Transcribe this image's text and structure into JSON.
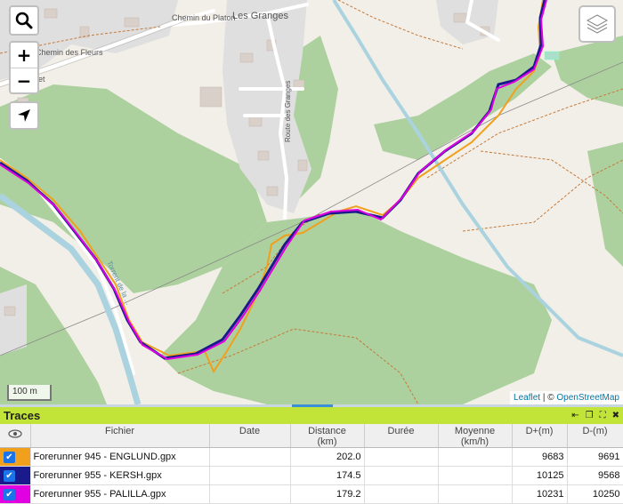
{
  "map": {
    "labels": {
      "les_granges": "Les Granges",
      "chemin_platon": "Chemin du Platon",
      "chemin_fleurs": "Chemin des Fleurs",
      "route_granges": "Route des Granges",
      "torrent": "Torrent de la ...",
      "cut_left": "het"
    },
    "zoom_in": "+",
    "zoom_out": "−",
    "scale_label": "100 m",
    "attribution": {
      "leaflet": "Leaflet",
      "sep": " | © ",
      "osm": "OpenStreetMap"
    },
    "track_colors": {
      "englund": "#f0a01c",
      "kersh": "#1a1a8c",
      "palilla": "#e100e1"
    }
  },
  "panel": {
    "title": "Traces",
    "icons": {
      "dock": "⇤",
      "restore": "❐",
      "expand": "⛶",
      "close": "✖"
    },
    "columns": [
      "",
      "Fichier",
      "Date",
      "Distance\n(km)",
      "Durée",
      "Moyenne\n(km/h)",
      "D+(m)",
      "D-(m)"
    ],
    "rows": [
      {
        "color": "#f0a01c",
        "checked": true,
        "file": "Forerunner 945 - ENGLUND.gpx",
        "date": "",
        "distance": "202.0",
        "duration": "",
        "speed": "",
        "dplus": "9683",
        "dminus": "9691"
      },
      {
        "color": "#1a1a8c",
        "checked": true,
        "file": "Forerunner 955 - KERSH.gpx",
        "date": "",
        "distance": "174.5",
        "duration": "",
        "speed": "",
        "dplus": "10125",
        "dminus": "9568"
      },
      {
        "color": "#e100e1",
        "checked": true,
        "file": "Forerunner 955 - PALILLA.gpx",
        "date": "",
        "distance": "179.2",
        "duration": "",
        "speed": "",
        "dplus": "10231",
        "dminus": "10250"
      }
    ]
  }
}
